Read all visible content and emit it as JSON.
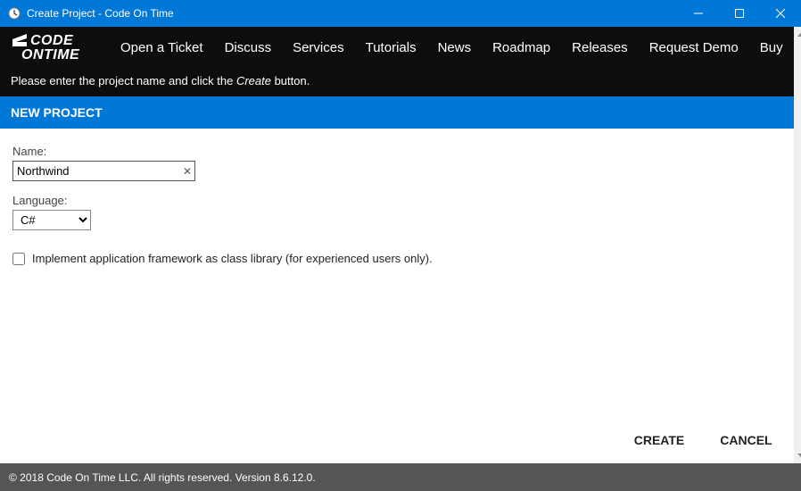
{
  "window": {
    "title": "Create Project - Code On Time"
  },
  "logo": {
    "line1": "CODE",
    "line2": "ONTIME"
  },
  "nav": {
    "items": [
      "Open a Ticket",
      "Discuss",
      "Services",
      "Tutorials",
      "News",
      "Roadmap",
      "Releases",
      "Request Demo",
      "Buy"
    ]
  },
  "instruction": {
    "prefix": "Please enter the project name and click the ",
    "emphasis": "Create",
    "suffix": " button."
  },
  "banner": {
    "title": "NEW PROJECT"
  },
  "form": {
    "name_label": "Name:",
    "name_value": "Northwind",
    "language_label": "Language:",
    "language_value": "C#",
    "checkbox_label": "Implement application framework as class library (for experienced users only)."
  },
  "actions": {
    "create": "CREATE",
    "cancel": "CANCEL"
  },
  "status": {
    "text": "© 2018 Code On Time LLC. All rights reserved. Version 8.6.12.0."
  }
}
